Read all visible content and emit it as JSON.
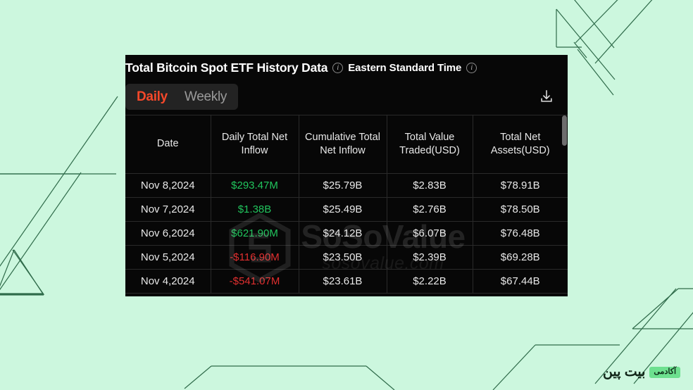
{
  "background": {
    "color": "#ccf7de",
    "line_color": "#2f6b4a"
  },
  "branding": {
    "badge": "آکادمی",
    "name": "بیت پین",
    "badge_color": "#6de08f"
  },
  "panel": {
    "background": "#070707",
    "header": {
      "title": "Total Bitcoin Spot ETF History Data",
      "title_info_icon": "info-icon",
      "timezone": "Eastern Standard Time",
      "timezone_info_icon": "info-icon"
    },
    "toolbar": {
      "tabs": [
        {
          "label": "Daily",
          "active": true
        },
        {
          "label": "Weekly",
          "active": false
        }
      ],
      "active_color": "#f5482a",
      "inactive_color": "#9b9b9b",
      "download_icon": "download-icon"
    },
    "watermark": {
      "main": "SoSoValue",
      "sub": "sosovalue.com",
      "logo": "sosovalue-hex-logo"
    },
    "scrollbar": {
      "thumb_color": "#6d6d6d"
    }
  },
  "table": {
    "columns": [
      "Date",
      "Daily Total Net Inflow",
      "Cumulative Total Net Inflow",
      "Total Value Traded(USD)",
      "Total Net Assets(USD)"
    ],
    "positive_color": "#21c45d",
    "negative_color": "#e02f2f",
    "rows": [
      {
        "date": "Nov 8,2024",
        "daily_net_inflow": "$293.47M",
        "daily_sign": "pos",
        "cumulative_net_inflow": "$25.79B",
        "total_value_traded": "$2.83B",
        "total_net_assets": "$78.91B"
      },
      {
        "date": "Nov 7,2024",
        "daily_net_inflow": "$1.38B",
        "daily_sign": "pos",
        "cumulative_net_inflow": "$25.49B",
        "total_value_traded": "$2.76B",
        "total_net_assets": "$78.50B"
      },
      {
        "date": "Nov 6,2024",
        "daily_net_inflow": "$621.90M",
        "daily_sign": "pos",
        "cumulative_net_inflow": "$24.12B",
        "total_value_traded": "$6.07B",
        "total_net_assets": "$76.48B"
      },
      {
        "date": "Nov 5,2024",
        "daily_net_inflow": "-$116.90M",
        "daily_sign": "neg",
        "cumulative_net_inflow": "$23.50B",
        "total_value_traded": "$2.39B",
        "total_net_assets": "$69.28B"
      },
      {
        "date": "Nov 4,2024",
        "daily_net_inflow": "-$541.07M",
        "daily_sign": "neg",
        "cumulative_net_inflow": "$23.61B",
        "total_value_traded": "$2.22B",
        "total_net_assets": "$67.44B"
      }
    ]
  }
}
